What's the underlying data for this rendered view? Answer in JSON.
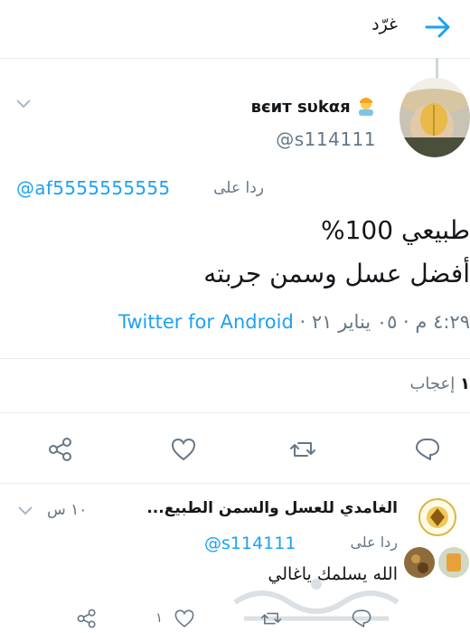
{
  "header": {
    "title": "غرّد"
  },
  "tweet": {
    "display_name": "вєит sυkαя",
    "handle": "@s114111",
    "reply_label": "ردا على",
    "reply_handle": "@af5555555555",
    "lines": [
      "طبيعي 100%",
      "أفضل عسل وسمن جربته"
    ],
    "time": "٤:٢٩ م · ٠٥ يناير ٢١ ·",
    "source": "Twitter for Android",
    "likes_count": "١",
    "likes_label": "إعجاب"
  },
  "reply": {
    "name": "الغامدي للعسل والسمن الطبيع...",
    "time": "١٠ س",
    "reply_label": "ردا على",
    "reply_handle": "@s114111",
    "text": "الله يسلمك ياغالي",
    "like_count": "١"
  },
  "colors": {
    "accent": "#1da1f2",
    "muted": "#657786",
    "text": "#14171a",
    "divider": "#e6ecf0"
  }
}
